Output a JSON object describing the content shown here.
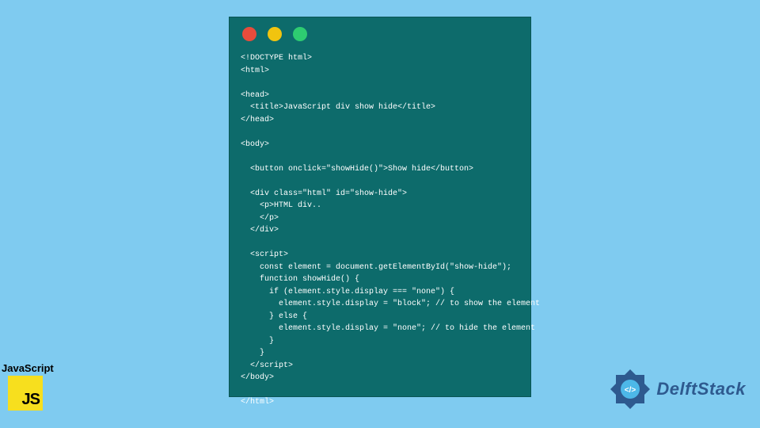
{
  "window": {
    "dots": [
      "red",
      "yellow",
      "green"
    ]
  },
  "code": {
    "text": "<!DOCTYPE html>\n<html>\n\n<head>\n  <title>JavaScript div show hide</title>\n</head>\n\n<body>\n\n  <button onclick=\"showHide()\">Show hide</button>\n\n  <div class=\"html\" id=\"show-hide\">\n    <p>HTML div..\n    </p>\n  </div>\n\n  <script>\n    const element = document.getElementById(\"show-hide\");\n    function showHide() {\n      if (element.style.display === \"none\") {\n        element.style.display = \"block\"; // to show the element\n      } else {\n        element.style.display = \"none\"; // to hide the element\n      }\n    }\n  </script>\n</body>\n\n</html>"
  },
  "badges": {
    "js_label": "JavaScript",
    "js_logo_text": "JS",
    "delft_text": "DelftStack"
  }
}
